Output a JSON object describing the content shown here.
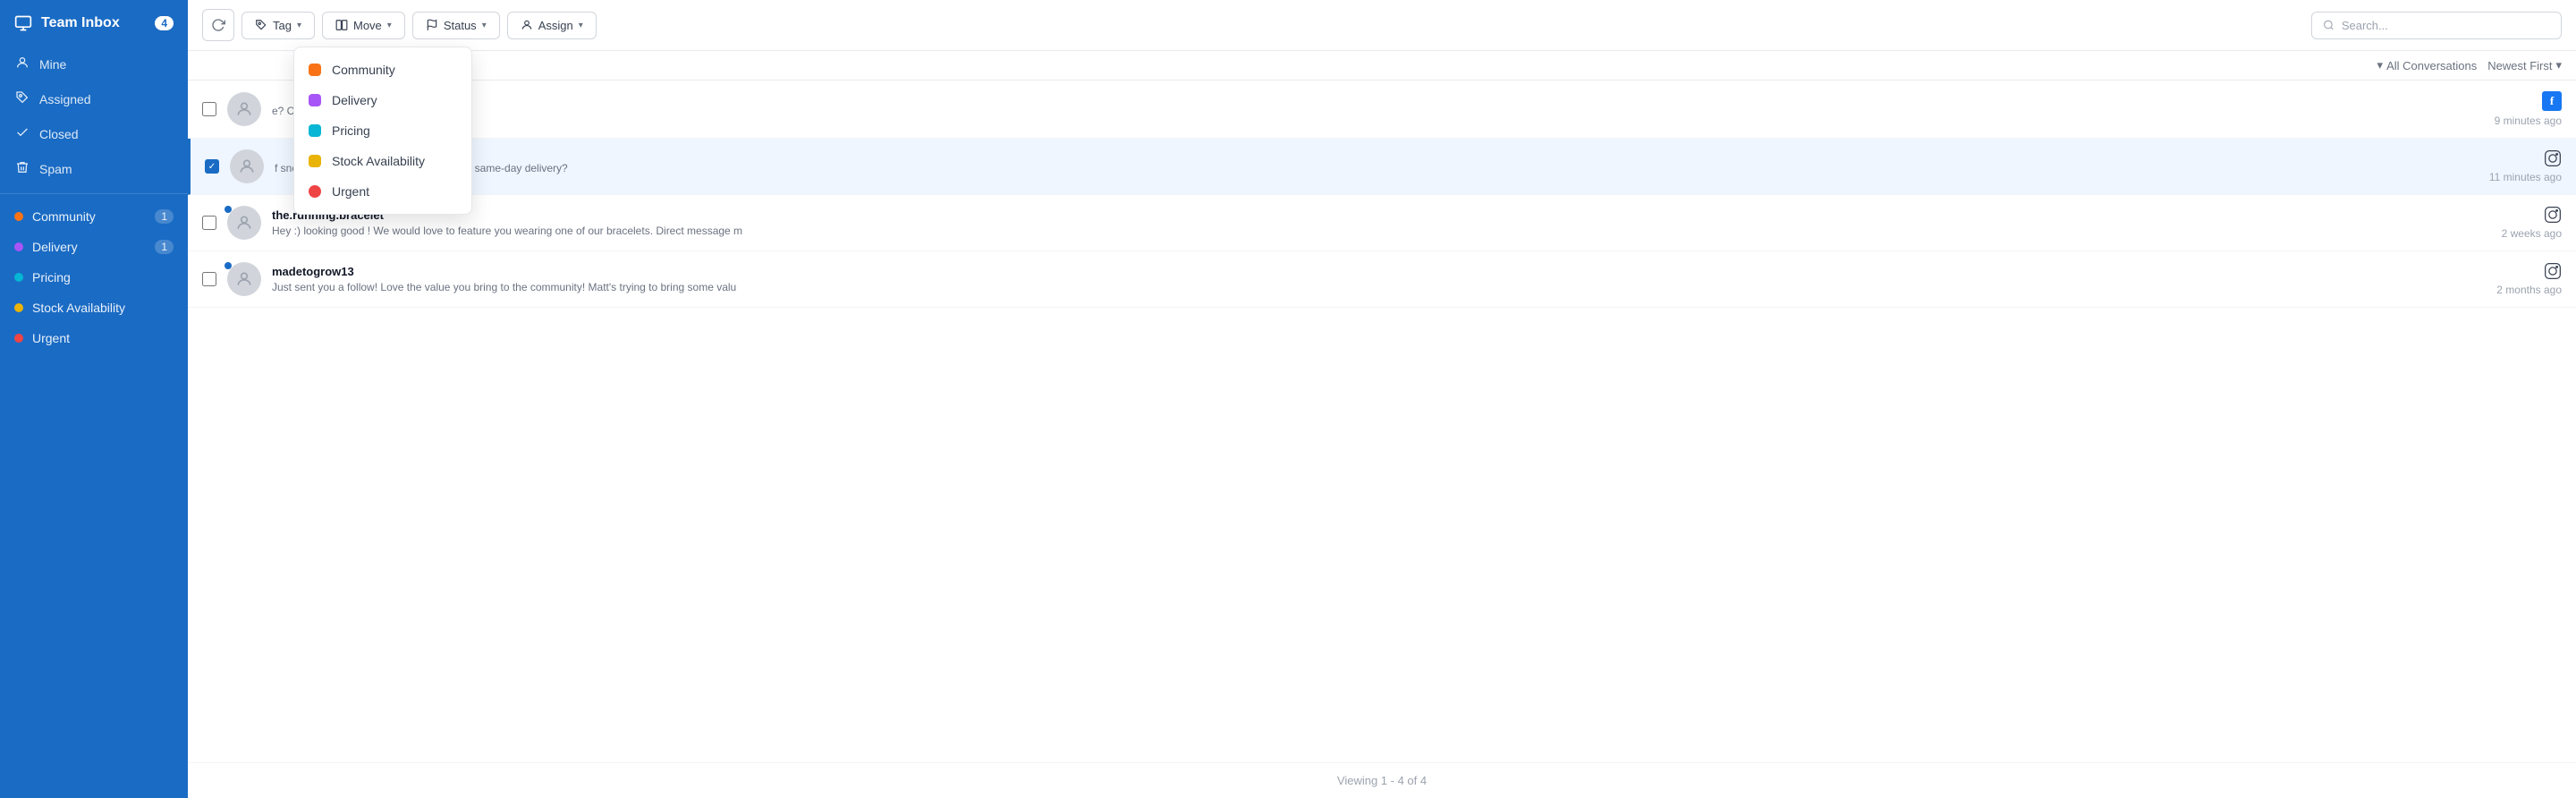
{
  "sidebar": {
    "title": "Team Inbox",
    "badge": "4",
    "nav_items": [
      {
        "id": "mine",
        "label": "Mine",
        "icon": "person"
      },
      {
        "id": "assigned",
        "label": "Assigned",
        "icon": "tag"
      },
      {
        "id": "closed",
        "label": "Closed",
        "icon": "check"
      },
      {
        "id": "spam",
        "label": "Spam",
        "icon": "trash"
      }
    ],
    "labels": [
      {
        "id": "community",
        "label": "Community",
        "color": "#f97316",
        "count": "1"
      },
      {
        "id": "delivery",
        "label": "Delivery",
        "color": "#a855f7",
        "count": "1"
      },
      {
        "id": "pricing",
        "label": "Pricing",
        "color": "#06b6d4",
        "count": null
      },
      {
        "id": "stock",
        "label": "Stock Availability",
        "color": "#eab308",
        "count": null
      },
      {
        "id": "urgent",
        "label": "Urgent",
        "color": "#ef4444",
        "count": null
      }
    ]
  },
  "toolbar": {
    "refresh_label": "↺",
    "tag_label": "Tag",
    "move_label": "Move",
    "status_label": "Status",
    "assign_label": "Assign",
    "search_placeholder": "Search..."
  },
  "dropdown": {
    "visible": true,
    "items": [
      {
        "id": "community",
        "label": "Community",
        "color": "#f97316"
      },
      {
        "id": "delivery",
        "label": "Delivery",
        "color": "#a855f7"
      },
      {
        "id": "pricing",
        "label": "Pricing",
        "color": "#06b6d4"
      },
      {
        "id": "stock",
        "label": "Stock Availability",
        "color": "#eab308"
      },
      {
        "id": "urgent",
        "label": "Urgent",
        "color": "#ef4444"
      }
    ]
  },
  "filter_bar": {
    "all_conversations": "All Conversations",
    "newest_first": "Newest First"
  },
  "conversations": [
    {
      "id": 1,
      "name": "",
      "preview": "e? Can't wait!",
      "time": "9 minutes ago",
      "platform": "facebook",
      "unread": false,
      "checked": false,
      "selected": false
    },
    {
      "id": 2,
      "name": "",
      "preview": "f sneakers as a gift by today. Do you offer same-day delivery?",
      "time": "11 minutes ago",
      "platform": "instagram",
      "unread": false,
      "checked": true,
      "selected": true
    },
    {
      "id": 3,
      "name": "the.running.bracelet",
      "preview": "Hey :) looking good ! We would love to feature you wearing one of our bracelets. Direct message m",
      "time": "2 weeks ago",
      "platform": "instagram",
      "unread": true,
      "checked": false,
      "selected": false
    },
    {
      "id": 4,
      "name": "madetogrow13",
      "preview": "Just sent you a follow! Love the value you bring to the community! Matt's trying to bring some valu",
      "time": "2 months ago",
      "platform": "instagram",
      "unread": true,
      "checked": false,
      "selected": false
    }
  ],
  "footer": {
    "viewing": "Viewing 1 - 4 of 4"
  }
}
